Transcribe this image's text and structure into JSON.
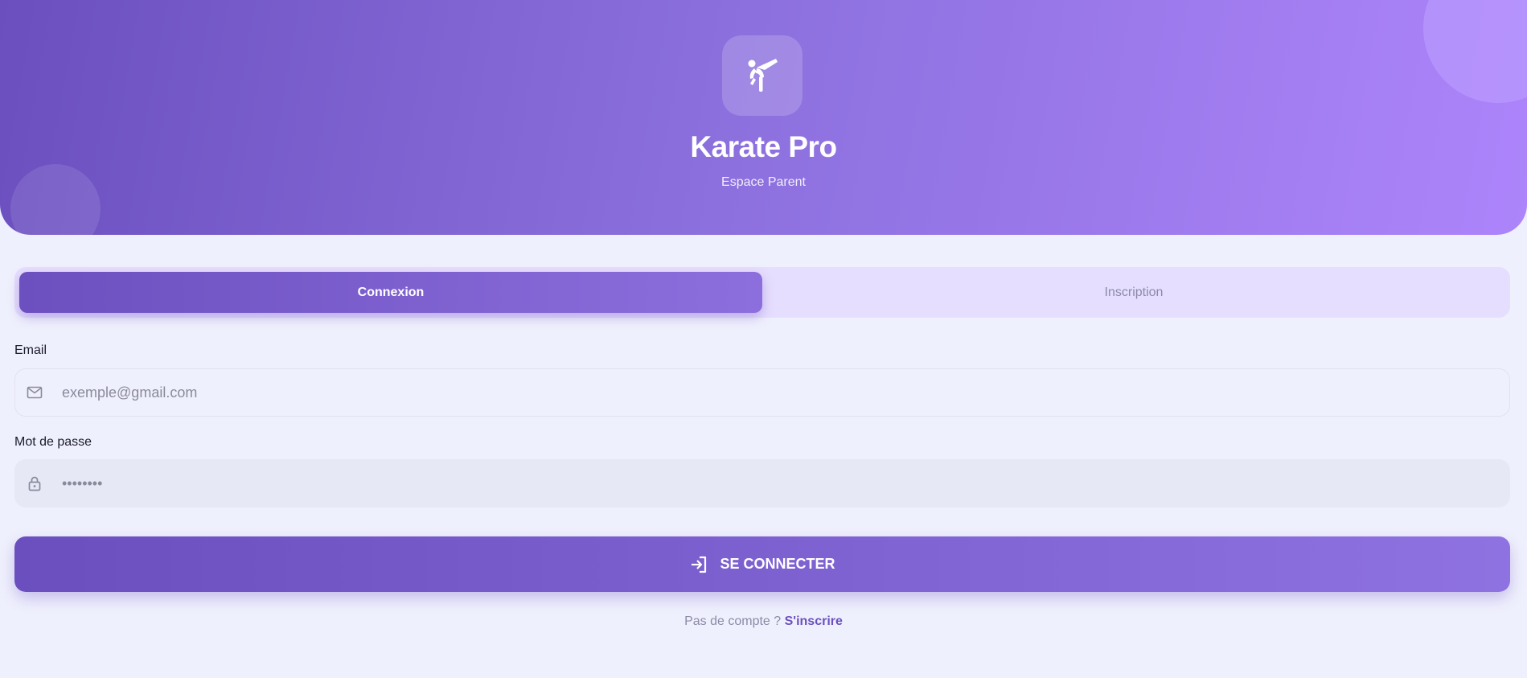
{
  "app": {
    "title": "Karate Pro",
    "subtitle": "Espace Parent",
    "logo_icon": "karate-kick-icon"
  },
  "tabs": [
    {
      "label": "Connexion",
      "active": true
    },
    {
      "label": "Inscription",
      "active": false
    }
  ],
  "form": {
    "email": {
      "label": "Email",
      "placeholder": "exemple@gmail.com",
      "value": "",
      "icon": "mail-icon"
    },
    "password": {
      "label": "Mot de passe",
      "placeholder": "",
      "value": "••••••••",
      "icon": "lock-icon"
    },
    "submit_label": "SE CONNECTER",
    "submit_icon": "login-icon"
  },
  "footer": {
    "text": "Pas de compte ?",
    "link_label": "S'inscrire"
  },
  "colors": {
    "primary": "#6c50bf",
    "primary_light": "#ad84fb",
    "background": "#eff0fd",
    "tab_track": "#e6defe"
  }
}
